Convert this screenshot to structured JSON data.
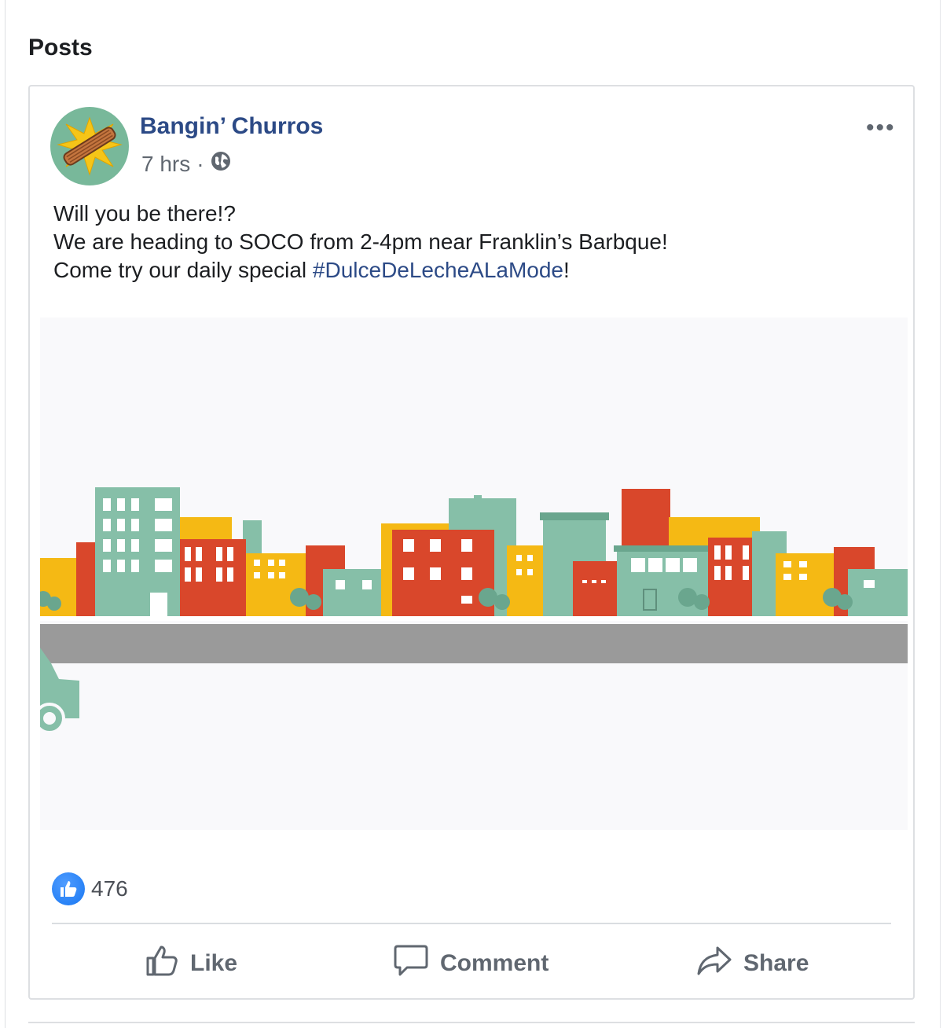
{
  "section": {
    "title": "Posts"
  },
  "post": {
    "author": "Bangin’ Churros",
    "time": "7 hrs",
    "separator": "·",
    "audience_icon": "globe-icon",
    "more_icon": "more-options-icon",
    "text_lines": [
      "Will you be there!?",
      "We are heading to SOCO from 2-4pm near Franklin’s Barbque!"
    ],
    "text_line3_prefix": "Come try our daily special ",
    "hashtag": "#DulceDeLecheALaMode",
    "text_line3_suffix": "!",
    "media": {
      "subject": "city-street-illustration"
    }
  },
  "reactions": {
    "icon": "like-reaction-icon",
    "count": "476"
  },
  "actions": {
    "like": "Like",
    "comment": "Comment",
    "share": "Share"
  },
  "colors": {
    "author": "#2c4a86",
    "hashtag": "#2c4a86",
    "teal": "#86bfa8",
    "red": "#d9472b",
    "yellow": "#f5b914",
    "road": "#9a9a9a",
    "like_blue": "#1877f2"
  }
}
